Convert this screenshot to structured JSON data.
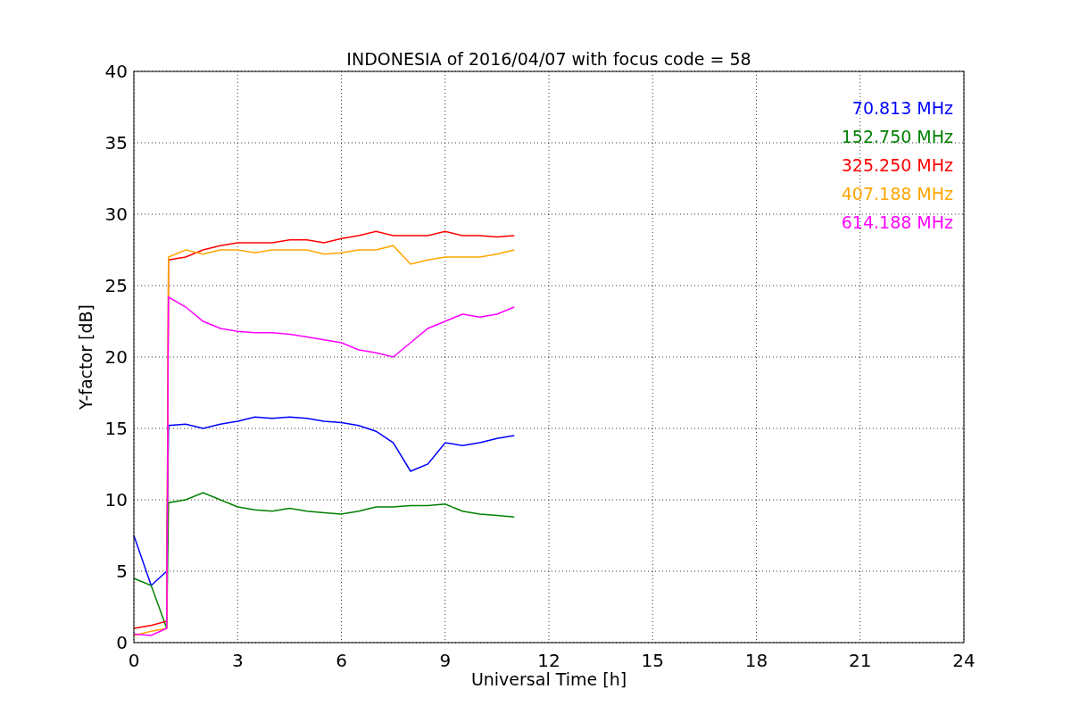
{
  "figure": {
    "chart_data": {
      "type": "line",
      "title": "INDONESIA of 2016/04/07 with focus code = 58",
      "xlabel": "Universal Time [h]",
      "ylabel": "Y-factor [dB]",
      "x": [
        0,
        0.5,
        0.95,
        1,
        1.5,
        2,
        2.5,
        3,
        3.5,
        4,
        4.5,
        5,
        5.5,
        6,
        6.5,
        7,
        7.5,
        8,
        8.5,
        9,
        9.5,
        10,
        10.5,
        11
      ],
      "series": [
        {
          "name": "70.813 MHz",
          "color": "#0000ff",
          "values": [
            7.5,
            4,
            5,
            15.2,
            15.3,
            15,
            15.3,
            15.5,
            15.8,
            15.7,
            15.8,
            15.7,
            15.5,
            15.4,
            15.2,
            14.8,
            14,
            12,
            12.5,
            14,
            13.8,
            14,
            14.3,
            14.5
          ]
        },
        {
          "name": "152.750 MHz",
          "color": "#008000",
          "values": [
            4.5,
            4,
            1,
            9.8,
            10,
            10.5,
            10,
            9.5,
            9.3,
            9.2,
            9.4,
            9.2,
            9.1,
            9,
            9.2,
            9.5,
            9.5,
            9.6,
            9.6,
            9.7,
            9.2,
            9,
            8.9,
            8.8
          ]
        },
        {
          "name": "325.250 MHz",
          "color": "#ff0000",
          "values": [
            1,
            1.2,
            1.5,
            26.8,
            27,
            27.5,
            27.8,
            28,
            28,
            28,
            28.2,
            28.2,
            28,
            28.3,
            28.5,
            28.8,
            28.5,
            28.5,
            28.5,
            28.8,
            28.5,
            28.5,
            28.4,
            28.5
          ]
        },
        {
          "name": "407.188 MHz",
          "color": "#ffa500",
          "values": [
            0.5,
            0.8,
            1,
            27,
            27.5,
            27.2,
            27.5,
            27.5,
            27.3,
            27.5,
            27.5,
            27.5,
            27.2,
            27.3,
            27.5,
            27.5,
            27.8,
            26.5,
            26.8,
            27,
            27,
            27,
            27.2,
            27.5
          ]
        },
        {
          "name": "614.188 MHz",
          "color": "#ff00ff",
          "values": [
            0.6,
            0.5,
            1,
            24.2,
            23.5,
            22.5,
            22,
            21.8,
            21.7,
            21.7,
            21.6,
            21.4,
            21.2,
            21,
            20.5,
            20.3,
            20,
            21,
            22,
            22.5,
            23,
            22.8,
            23,
            23.5
          ]
        }
      ],
      "xlim": [
        0,
        24
      ],
      "ylim": [
        0,
        40
      ],
      "xticks": [
        0,
        3,
        6,
        9,
        12,
        15,
        18,
        21,
        24
      ],
      "yticks": [
        0,
        5,
        10,
        15,
        20,
        25,
        30,
        35,
        40
      ],
      "grid": true
    }
  }
}
